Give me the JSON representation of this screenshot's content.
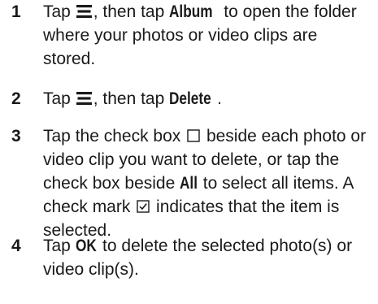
{
  "steps": [
    {
      "number": "1",
      "parts": [
        "Tap ",
        ", then tap ",
        " to open the folder where your photos or video clips are stored."
      ],
      "keyword": "Album",
      "icon": "menu-icon"
    },
    {
      "number": "2",
      "parts": [
        "Tap ",
        ", then tap ",
        "."
      ],
      "keyword": "Delete",
      "icon": "menu-icon"
    },
    {
      "number": "3",
      "parts": [
        "Tap the check box ",
        " beside each photo or video clip you want to delete, or tap the check box beside ",
        " to select all items. A check mark ",
        " indicates that the item is selected."
      ],
      "keyword": "All",
      "icons": [
        "empty-checkbox-icon",
        "checked-checkbox-icon"
      ]
    },
    {
      "number": "4",
      "parts": [
        "Tap ",
        " to delete the selected photo(s) or video clip(s)."
      ],
      "keyword": "OK"
    }
  ]
}
